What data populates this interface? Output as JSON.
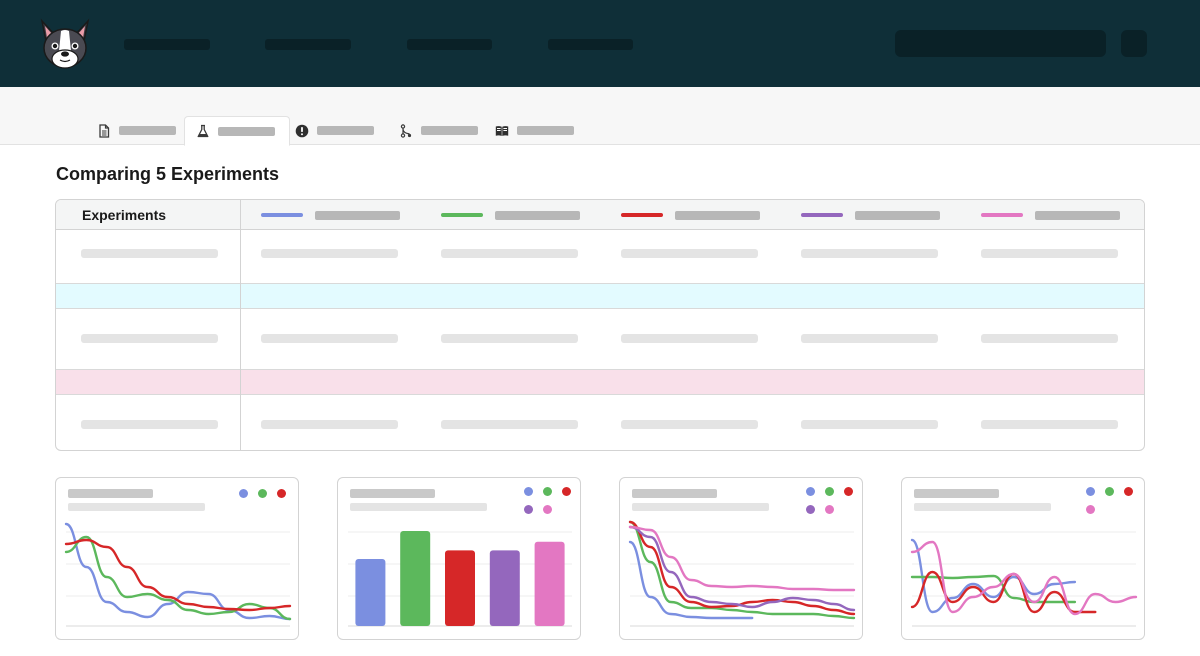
{
  "page": {
    "title": "Comparing 5 Experiments"
  },
  "tabs": [
    {
      "icon": "document-icon",
      "active": false
    },
    {
      "icon": "flask-icon",
      "active": true
    },
    {
      "icon": "alert-icon",
      "active": false
    },
    {
      "icon": "branch-icon",
      "active": false
    },
    {
      "icon": "book-icon",
      "active": false
    }
  ],
  "table": {
    "header_label": "Experiments",
    "experiments": [
      {
        "color": "#7b8fe0"
      },
      {
        "color": "#5cb85c"
      },
      {
        "color": "#d62728"
      },
      {
        "color": "#9467bd"
      },
      {
        "color": "#e377c2"
      }
    ],
    "highlight_rows": [
      {
        "color": "#e3fbff"
      },
      {
        "color": "#f9e0ea"
      }
    ]
  },
  "colors": {
    "nav_background": "#0f2f38",
    "blue": "#7b8fe0",
    "green": "#5cb85c",
    "red": "#d62728",
    "purple": "#9467bd",
    "pink": "#e377c2"
  },
  "chart_data": [
    {
      "type": "line",
      "series": [
        {
          "color": "#7b8fe0",
          "values": [
            0.98,
            0.55,
            0.2,
            0.1,
            0.05,
            0.18,
            0.3,
            0.28,
            0.12,
            0.04,
            0.06,
            0.03
          ]
        },
        {
          "color": "#5cb85c",
          "values": [
            0.7,
            0.85,
            0.45,
            0.25,
            0.28,
            0.22,
            0.12,
            0.08,
            0.1,
            0.18,
            0.14,
            0.03
          ]
        },
        {
          "color": "#d62728",
          "values": [
            0.78,
            0.82,
            0.75,
            0.55,
            0.35,
            0.25,
            0.18,
            0.15,
            0.13,
            0.12,
            0.14,
            0.16
          ]
        }
      ]
    },
    {
      "type": "bar",
      "series": [
        {
          "color": "#7b8fe0",
          "value": 0.62
        },
        {
          "color": "#5cb85c",
          "value": 0.88
        },
        {
          "color": "#d62728",
          "value": 0.7
        },
        {
          "color": "#9467bd",
          "value": 0.7
        },
        {
          "color": "#e377c2",
          "value": 0.78
        }
      ]
    },
    {
      "type": "line",
      "series": [
        {
          "color": "#7b8fe0",
          "values": [
            0.8,
            0.25,
            0.08,
            0.05,
            0.04,
            0.04,
            0.04
          ]
        },
        {
          "color": "#5cb85c",
          "values": [
            1.0,
            0.6,
            0.2,
            0.14,
            0.14,
            0.12,
            0.1,
            0.08,
            0.08,
            0.08,
            0.06,
            0.04
          ]
        },
        {
          "color": "#d62728",
          "values": [
            1.0,
            0.75,
            0.35,
            0.2,
            0.15,
            0.16,
            0.2,
            0.22,
            0.2,
            0.16,
            0.12,
            0.08
          ]
        },
        {
          "color": "#9467bd",
          "values": [
            0.95,
            0.85,
            0.5,
            0.25,
            0.2,
            0.18,
            0.15,
            0.2,
            0.24,
            0.22,
            0.18,
            0.12
          ]
        },
        {
          "color": "#e377c2",
          "values": [
            0.95,
            0.92,
            0.65,
            0.42,
            0.36,
            0.35,
            0.36,
            0.35,
            0.33,
            0.33,
            0.32,
            0.32
          ]
        }
      ]
    },
    {
      "type": "line",
      "series": [
        {
          "color": "#7b8fe0",
          "values": [
            0.82,
            0.1,
            0.24,
            0.38,
            0.25,
            0.45,
            0.28,
            0.38,
            0.4
          ]
        },
        {
          "color": "#5cb85c",
          "values": [
            0.45,
            0.45,
            0.44,
            0.45,
            0.46,
            0.24,
            0.2,
            0.2,
            0.2
          ]
        },
        {
          "color": "#d62728",
          "values": [
            0.15,
            0.5,
            0.2,
            0.35,
            0.2,
            0.48,
            0.1,
            0.3,
            0.1,
            0.1
          ]
        },
        {
          "color": "#e377c2",
          "values": [
            0.7,
            0.8,
            0.1,
            0.25,
            0.35,
            0.48,
            0.2,
            0.45,
            0.08,
            0.28,
            0.2,
            0.25
          ]
        }
      ]
    }
  ]
}
